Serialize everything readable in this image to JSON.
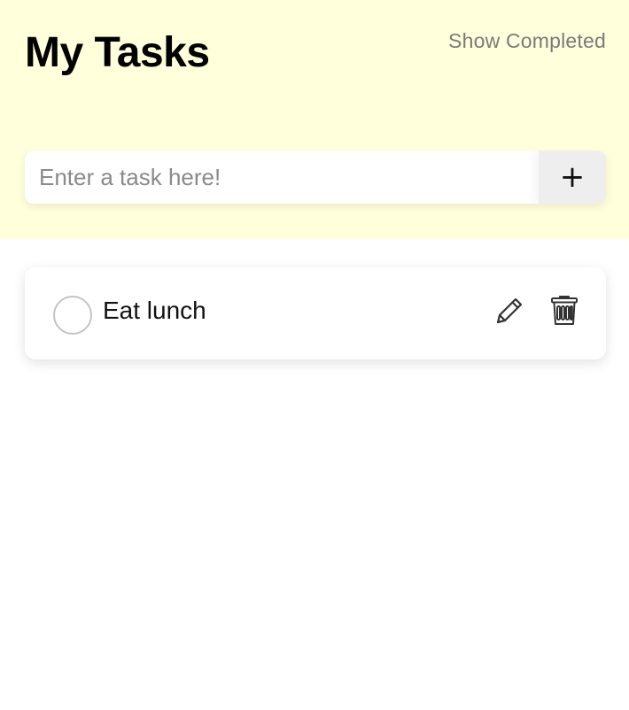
{
  "header": {
    "title": "My Tasks",
    "show_completed_label": "Show Completed",
    "background_color": "#ffffdb"
  },
  "new_task": {
    "value": "",
    "placeholder": "Enter a task here!",
    "add_button_label": "+"
  },
  "tasks": [
    {
      "label": "Eat lunch",
      "completed": false,
      "icons": [
        "pencil-icon",
        "trash-icon"
      ]
    }
  ]
}
